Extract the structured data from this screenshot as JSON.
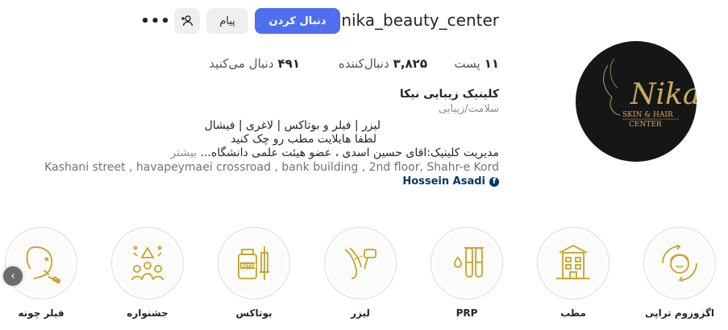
{
  "profile": {
    "username": "nika_beauty_center",
    "follow_label": "دنبال کردن",
    "message_label": "پیام",
    "more_label": "•••",
    "logo_text": "Nika",
    "logo_sub1": "SKIN & HAIR",
    "logo_sub2": "CENTER"
  },
  "stats": {
    "posts_count": "۱۱",
    "posts_label": "پست",
    "followers_count": "۳,۸۲۵",
    "followers_label": "دنبال‌کننده",
    "following_count": "۴۹۱",
    "following_label": "دنبال می‌کنید"
  },
  "bio": {
    "name": "کلینیک زیبایی نیکا",
    "category": "سلامت/زیبایی",
    "line1": "لیزر | فیلر و بوتاکس | لاغری | فیشال",
    "line2": "لطفا هایلایت مطب رو چک کنید",
    "line3": "مدیریت کلینیک:اقای حسین اسدی ، عضو هیئت علمی دانشگاه...",
    "more": "بیشتر",
    "address": "Kashani street , havapeymaei crossroad , bank building , 2nd floor, Shahr-e Kord",
    "link": "Hossein Asadi"
  },
  "highlights": [
    {
      "label": "اگزوزوم تراپی",
      "icon": "face-spa-icon"
    },
    {
      "label": "مطب",
      "icon": "building-icon"
    },
    {
      "label": "PRP",
      "icon": "prp-tubes-icon"
    },
    {
      "label": "لیزر",
      "icon": "laser-icon"
    },
    {
      "label": "بوتاکس",
      "icon": "botox-icon"
    },
    {
      "label": "جشنواره",
      "icon": "celebration-icon"
    },
    {
      "label": "فیلر چونه",
      "icon": "chin-filler-icon"
    }
  ],
  "colors": {
    "accent": "#4f6ff0",
    "highlight_gold": "#c9a227",
    "avatar_bg": "#161616"
  }
}
